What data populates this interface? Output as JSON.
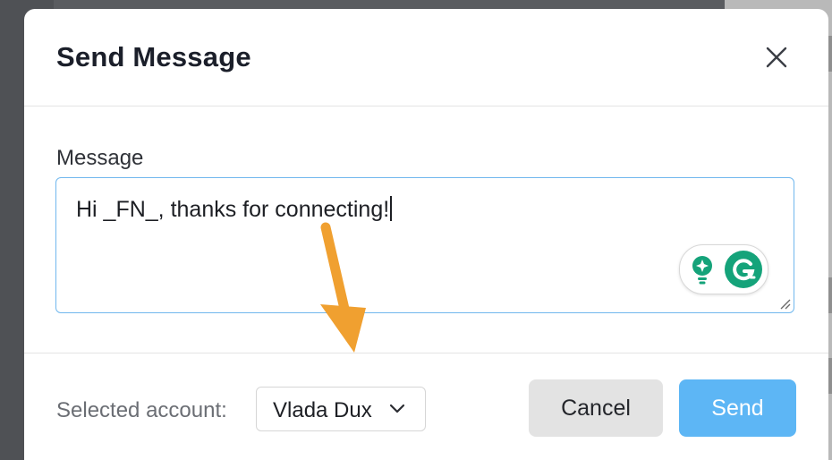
{
  "modal": {
    "title": "Send Message",
    "close_icon": "close-icon"
  },
  "message": {
    "label": "Message",
    "text": "Hi _FN_, thanks for connecting!"
  },
  "grammarly": {
    "icons": [
      "lightbulb-icon",
      "grammarly-g-icon"
    ],
    "color": "#15a37a"
  },
  "annotation": {
    "arrow_color": "#f0a030"
  },
  "footer": {
    "account_label": "Selected account:",
    "account_value": "Vlada Dux",
    "cancel_label": "Cancel",
    "send_label": "Send"
  },
  "colors": {
    "accent": "#5db6f5",
    "focus_border": "#71b8ee",
    "cancel_bg": "#e3e3e3"
  }
}
